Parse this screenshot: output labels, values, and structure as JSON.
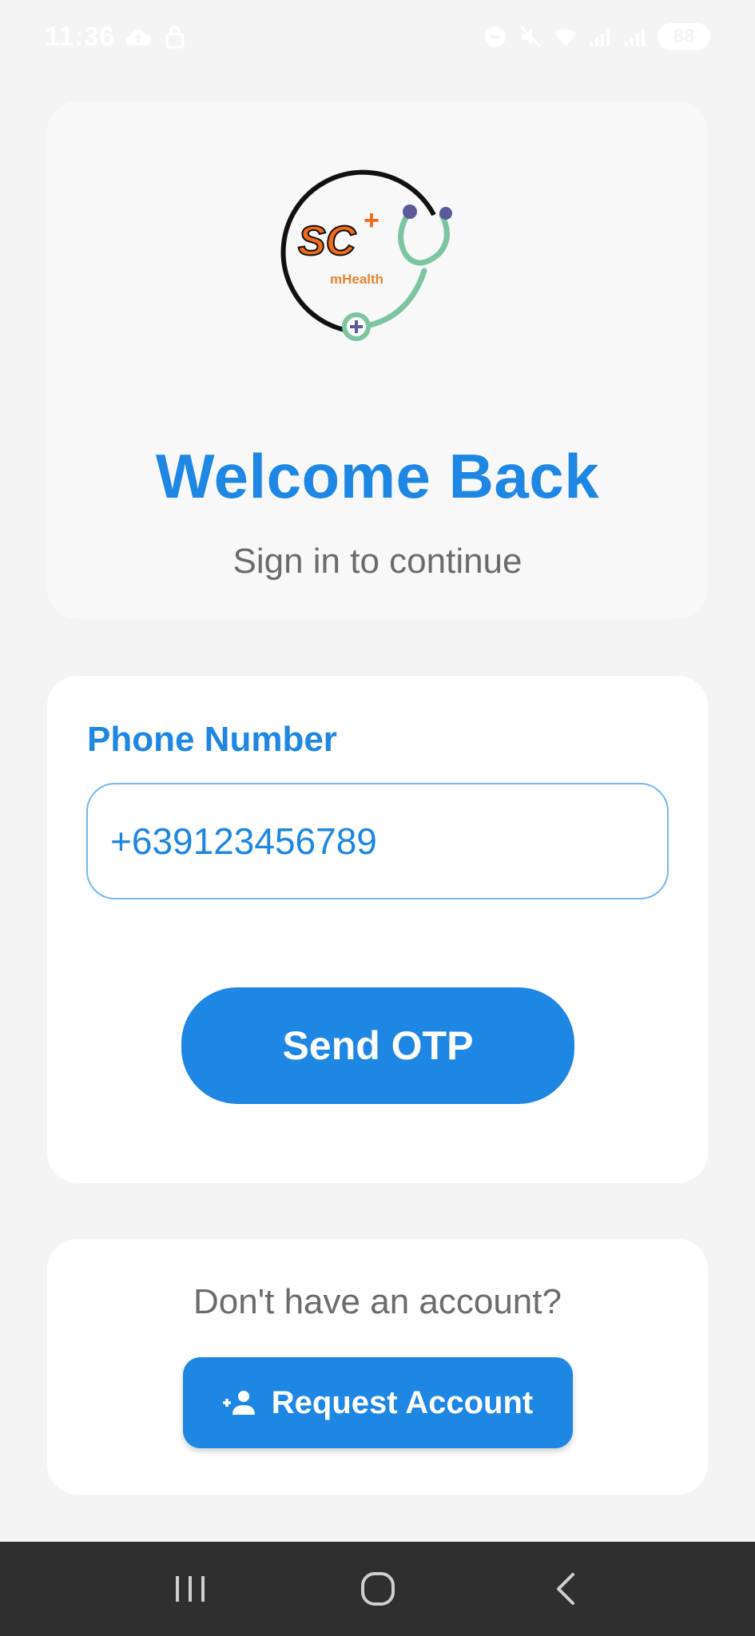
{
  "status_bar": {
    "time": "11:36",
    "battery": "88",
    "text_color": "#ffffff"
  },
  "header": {
    "logo": {
      "brand_text": "SC",
      "plus_sign": "+",
      "sub_text": "mHealth",
      "colors": {
        "brand": "#f26a1b",
        "tube": "#7cc5a0",
        "earpiece": "#5b5a9a",
        "ring": "#111111"
      }
    },
    "title": "Welcome Back",
    "subtitle": "Sign in to continue"
  },
  "form": {
    "phone_label": "Phone Number",
    "phone_value": "+639123456789",
    "send_button_label": "Send OTP"
  },
  "account": {
    "prompt": "Don't have an account?",
    "request_button_label": "Request Account",
    "request_icon": "person-add-icon"
  },
  "nav_bar": {
    "buttons": [
      "recent-apps-icon",
      "home-icon",
      "back-icon"
    ]
  },
  "theme": {
    "accent": "#1e86e3",
    "background": "#f4f4f5",
    "muted_text": "#6b6b6b"
  }
}
